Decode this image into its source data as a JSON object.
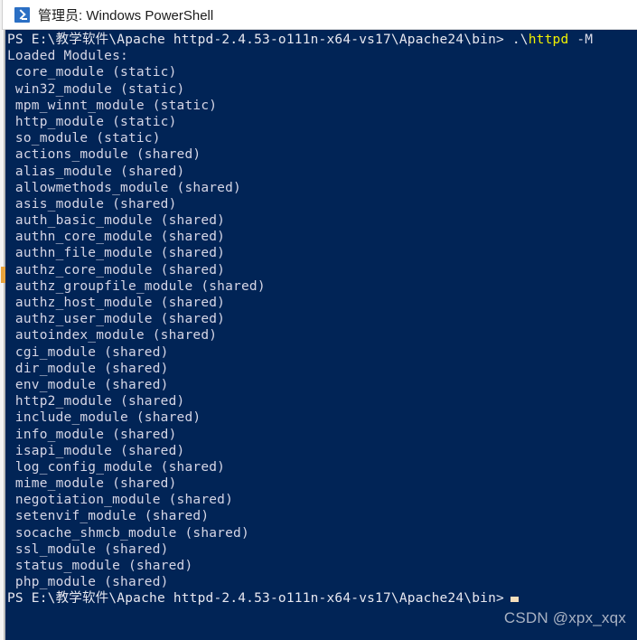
{
  "window": {
    "title": "管理员: Windows PowerShell",
    "icon": "powershell-icon",
    "background_color": "#012456",
    "titlebar_color": "#ffffff"
  },
  "terminal": {
    "prompt_path": "PS E:\\教学软件\\Apache httpd-2.4.53-o111n-x64-vs17\\Apache24\\bin>",
    "command_prefix": ".\\",
    "command_name": "httpd",
    "command_args": "-M",
    "command_color": "#f2f200",
    "text_color": "#d6d6e6",
    "header": "Loaded Modules:",
    "final_prompt": "PS E:\\教学软件\\Apache httpd-2.4.53-o111n-x64-vs17\\Apache24\\bin>",
    "cursor": "block-cursor",
    "modules": [
      " core_module (static)",
      " win32_module (static)",
      " mpm_winnt_module (static)",
      " http_module (static)",
      " so_module (static)",
      " actions_module (shared)",
      " alias_module (shared)",
      " allowmethods_module (shared)",
      " asis_module (shared)",
      " auth_basic_module (shared)",
      " authn_core_module (shared)",
      " authn_file_module (shared)",
      " authz_core_module (shared)",
      " authz_groupfile_module (shared)",
      " authz_host_module (shared)",
      " authz_user_module (shared)",
      " autoindex_module (shared)",
      " cgi_module (shared)",
      " dir_module (shared)",
      " env_module (shared)",
      " http2_module (shared)",
      " include_module (shared)",
      " info_module (shared)",
      " isapi_module (shared)",
      " log_config_module (shared)",
      " mime_module (shared)",
      " negotiation_module (shared)",
      " setenvif_module (shared)",
      " socache_shmcb_module (shared)",
      " ssl_module (shared)",
      " status_module (shared)",
      " php_module (shared)"
    ]
  },
  "watermark": {
    "text": "CSDN @xpx_xqx",
    "color": "#a9b2c3"
  }
}
